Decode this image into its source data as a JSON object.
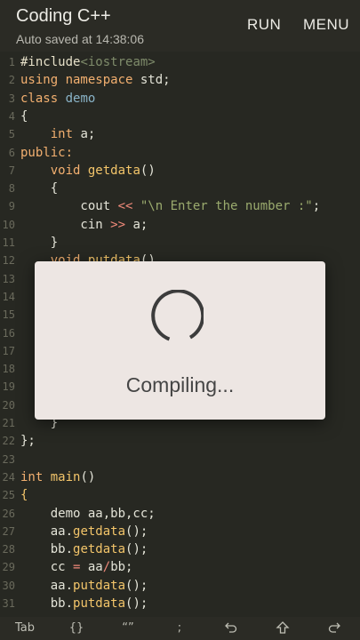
{
  "app": {
    "title": "Coding C++",
    "subtitle": "Auto saved at 14:38:06",
    "run_label": "RUN",
    "menu_label": "MENU"
  },
  "dialog": {
    "message": "Compiling..."
  },
  "toolbar": {
    "tab": "Tab",
    "braces": "{}",
    "quotes": "“”",
    "semicolon": ";"
  },
  "code": [
    {
      "n": "1",
      "segs": [
        [
          "#include",
          "pp"
        ],
        [
          "<iostream>",
          "inc"
        ]
      ]
    },
    {
      "n": "2",
      "segs": [
        [
          "using namespace",
          "k"
        ],
        [
          " std;",
          ""
        ]
      ]
    },
    {
      "n": "3",
      "segs": [
        [
          "class",
          "k"
        ],
        [
          " ",
          ""
        ],
        [
          "demo",
          "cls"
        ]
      ]
    },
    {
      "n": "4",
      "segs": [
        [
          "{",
          ""
        ]
      ]
    },
    {
      "n": "5",
      "segs": [
        [
          "    ",
          ""
        ],
        [
          "int",
          "k"
        ],
        [
          " a;",
          ""
        ]
      ]
    },
    {
      "n": "6",
      "segs": [
        [
          "public:",
          "k"
        ]
      ]
    },
    {
      "n": "7",
      "segs": [
        [
          "    ",
          ""
        ],
        [
          "void",
          "k"
        ],
        [
          " ",
          ""
        ],
        [
          "getdata",
          "fn"
        ],
        [
          "()",
          ""
        ]
      ]
    },
    {
      "n": "8",
      "segs": [
        [
          "    {",
          ""
        ]
      ]
    },
    {
      "n": "9",
      "segs": [
        [
          "        cout ",
          ""
        ],
        [
          "<<",
          "op"
        ],
        [
          " ",
          ""
        ],
        [
          "\"\\n Enter the number :\"",
          "str"
        ],
        [
          ";",
          ""
        ]
      ]
    },
    {
      "n": "10",
      "segs": [
        [
          "        cin ",
          ""
        ],
        [
          ">>",
          "op"
        ],
        [
          " a;",
          ""
        ]
      ]
    },
    {
      "n": "11",
      "segs": [
        [
          "    }",
          ""
        ]
      ]
    },
    {
      "n": "12",
      "segs": [
        [
          "    ",
          ""
        ],
        [
          "void",
          "k"
        ],
        [
          " ",
          ""
        ],
        [
          "putdata",
          "fn"
        ],
        [
          "()",
          ""
        ]
      ]
    },
    {
      "n": "13",
      "segs": []
    },
    {
      "n": "14",
      "segs": []
    },
    {
      "n": "15",
      "segs": []
    },
    {
      "n": "16",
      "segs": []
    },
    {
      "n": "17",
      "segs": []
    },
    {
      "n": "18",
      "segs": []
    },
    {
      "n": "19",
      "segs": []
    },
    {
      "n": "20",
      "segs": []
    },
    {
      "n": "21",
      "segs": [
        [
          "    }",
          ""
        ]
      ]
    },
    {
      "n": "22",
      "segs": [
        [
          "};",
          ""
        ]
      ]
    },
    {
      "n": "23",
      "segs": []
    },
    {
      "n": "24",
      "segs": [
        [
          "int",
          "k"
        ],
        [
          " ",
          ""
        ],
        [
          "main",
          "fn"
        ],
        [
          "()",
          ""
        ]
      ]
    },
    {
      "n": "25",
      "segs": [
        [
          "{",
          "fn"
        ]
      ]
    },
    {
      "n": "26",
      "segs": [
        [
          "    demo aa,bb,cc;",
          ""
        ]
      ]
    },
    {
      "n": "27",
      "segs": [
        [
          "    aa.",
          ""
        ],
        [
          "getdata",
          "fn"
        ],
        [
          "();",
          ""
        ]
      ]
    },
    {
      "n": "28",
      "segs": [
        [
          "    bb.",
          ""
        ],
        [
          "getdata",
          "fn"
        ],
        [
          "();",
          ""
        ]
      ]
    },
    {
      "n": "29",
      "segs": [
        [
          "    cc ",
          ""
        ],
        [
          "=",
          "op"
        ],
        [
          " aa",
          ""
        ],
        [
          "/",
          "op"
        ],
        [
          "bb;",
          ""
        ]
      ]
    },
    {
      "n": "30",
      "segs": [
        [
          "    aa.",
          ""
        ],
        [
          "putdata",
          "fn"
        ],
        [
          "();",
          ""
        ]
      ]
    },
    {
      "n": "31",
      "segs": [
        [
          "    bb.",
          ""
        ],
        [
          "putdata",
          "fn"
        ],
        [
          "();",
          ""
        ]
      ]
    }
  ]
}
